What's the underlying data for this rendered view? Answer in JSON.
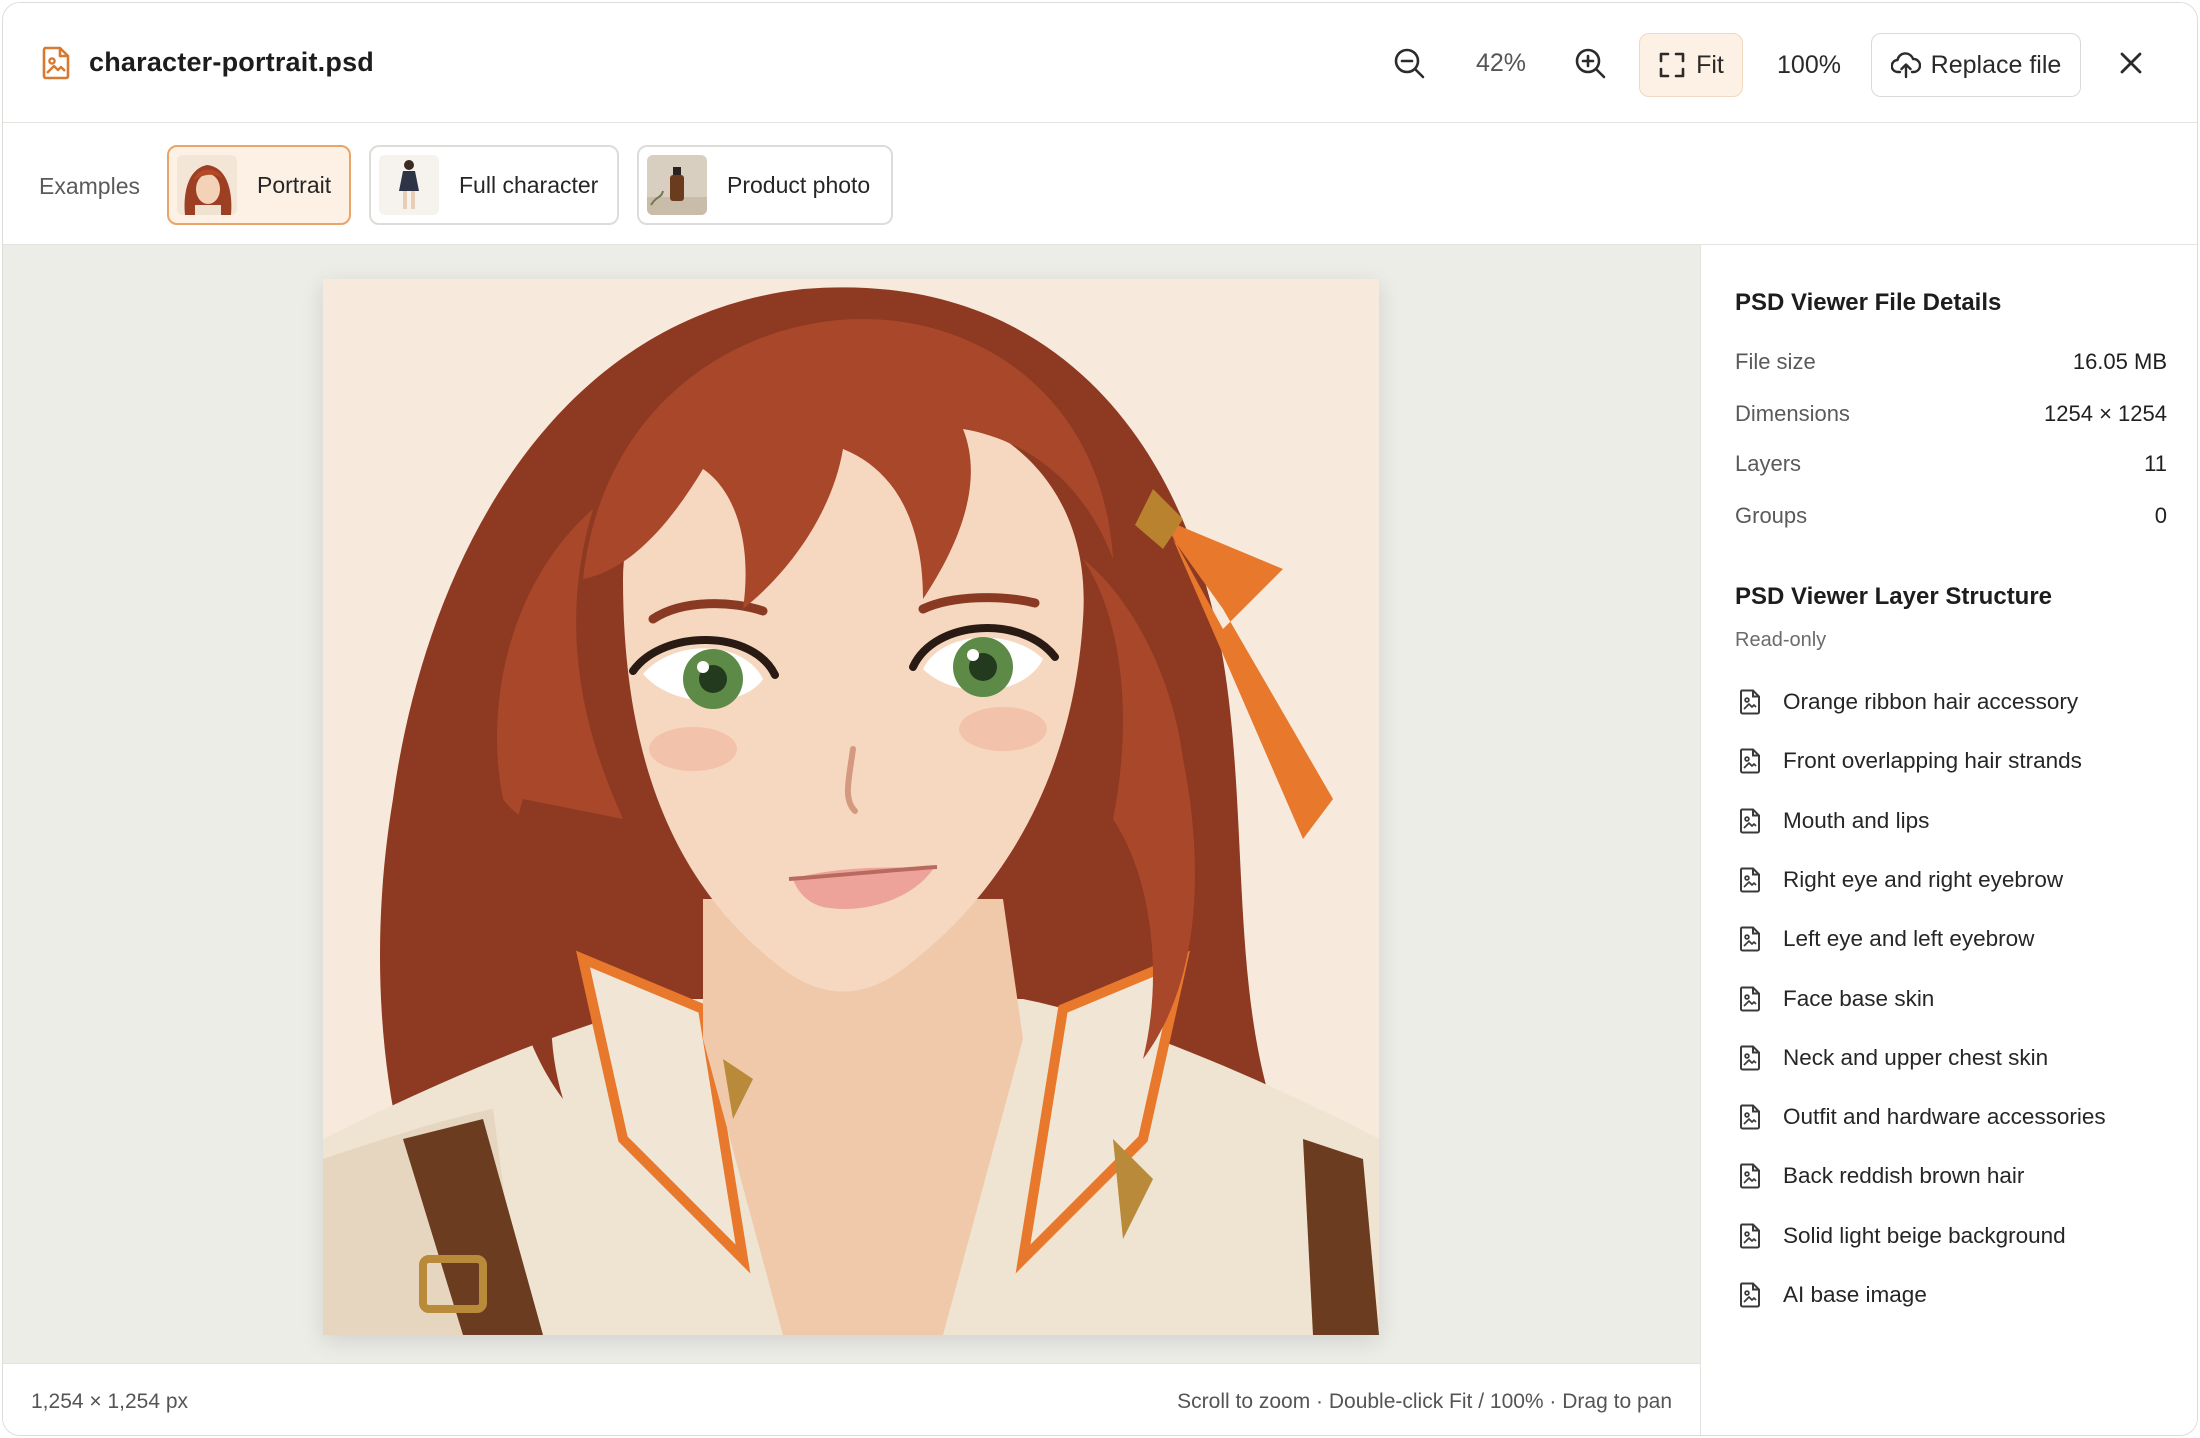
{
  "header": {
    "file_name": "character-portrait.psd",
    "zoom_level": "42%",
    "fit_label": "Fit",
    "actual_size_label": "100%",
    "replace_label": "Replace file"
  },
  "examples": {
    "label": "Examples",
    "items": [
      {
        "label": "Portrait",
        "active": true
      },
      {
        "label": "Full character",
        "active": false
      },
      {
        "label": "Product photo",
        "active": false
      }
    ]
  },
  "status": {
    "dimensions": "1,254 × 1,254 px",
    "hint": "Scroll to zoom · Double-click Fit / 100% · Drag to pan"
  },
  "details": {
    "title": "PSD Viewer File Details",
    "rows": [
      {
        "key": "File size",
        "value": "16.05 MB"
      },
      {
        "key": "Dimensions",
        "value": "1254 × 1254"
      },
      {
        "key": "Layers",
        "value": "11"
      },
      {
        "key": "Groups",
        "value": "0"
      }
    ]
  },
  "layers": {
    "title": "PSD Viewer Layer Structure",
    "subtitle": "Read-only",
    "items": [
      "Orange ribbon hair accessory",
      "Front overlapping hair strands",
      "Mouth and lips",
      "Right eye and right eyebrow",
      "Left eye and left eyebrow",
      "Face base skin",
      "Neck and upper chest skin",
      "Outfit and hardware accessories",
      "Back reddish brown hair",
      "Solid light beige background",
      "AI base image"
    ]
  },
  "colors": {
    "accent": "#e9a468",
    "accent_bg": "#fdf1e6",
    "canvas_bg": "#edede8",
    "file_icon": "#d9782f"
  },
  "icons": {
    "file": "file-image-icon",
    "zoom_out": "zoom-out-icon",
    "zoom_in": "zoom-in-icon",
    "fit": "fit-frame-icon",
    "replace": "cloud-upload-icon",
    "close": "close-icon",
    "layer": "layer-file-icon"
  }
}
